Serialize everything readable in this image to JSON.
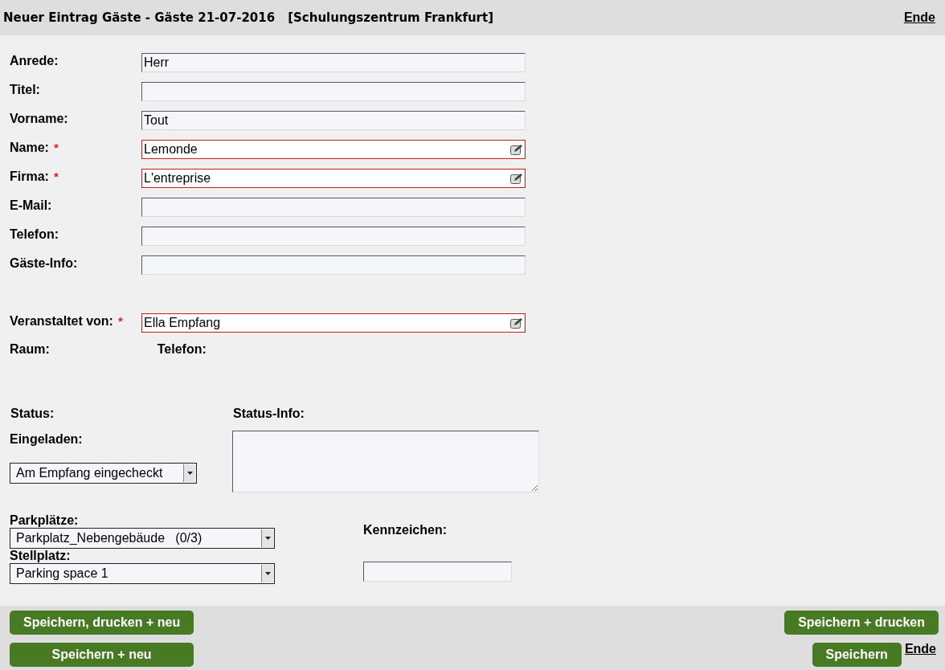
{
  "header": {
    "title": "Neuer Eintrag Gäste - Gäste 21-07-2016",
    "location": "[Schulungszentrum Frankfurt]",
    "end_link": "Ende"
  },
  "fields": [
    {
      "label": "Anrede:",
      "value": "Herr",
      "required": false
    },
    {
      "label": "Titel:",
      "required": false
    },
    {
      "label": "Vorname:",
      "value": "Tout",
      "required": false
    },
    {
      "label": "Name:",
      "required_mark": "*",
      "value": "Lemonde",
      "required": true
    },
    {
      "label": "Firma:",
      "required_mark": "*",
      "value": "L'entreprise",
      "required": true
    },
    {
      "label": "E-Mail:",
      "required": false
    },
    {
      "label": "Telefon:",
      "required": false
    },
    {
      "label": "Gäste-Info:",
      "required": false
    }
  ],
  "host": {
    "label": "Veranstaltet von:",
    "required_mark": "*",
    "value": "Ella Empfang",
    "required": true
  },
  "host_info": {
    "room_label": "Raum:",
    "phone_label": "Telefon:"
  },
  "status": {
    "label": "Status:",
    "sub_label": "Eingeladen:",
    "value": "Am Empfang eingecheckt",
    "info_label": "Status-Info:"
  },
  "parking": {
    "label": "Parkplätze:",
    "value": "Parkplatz_Nebengebäude   (0/3)",
    "space_label": "Stellplatz:",
    "space_value": "Parking space 1",
    "plate_label": "Kennzeichen:"
  },
  "buttons_left": [
    "Speichern, drucken + neu",
    "Speichern + neu"
  ],
  "buttons_right": [
    "Speichern + drucken",
    "Speichern"
  ],
  "footer_end_link": "Ende"
}
